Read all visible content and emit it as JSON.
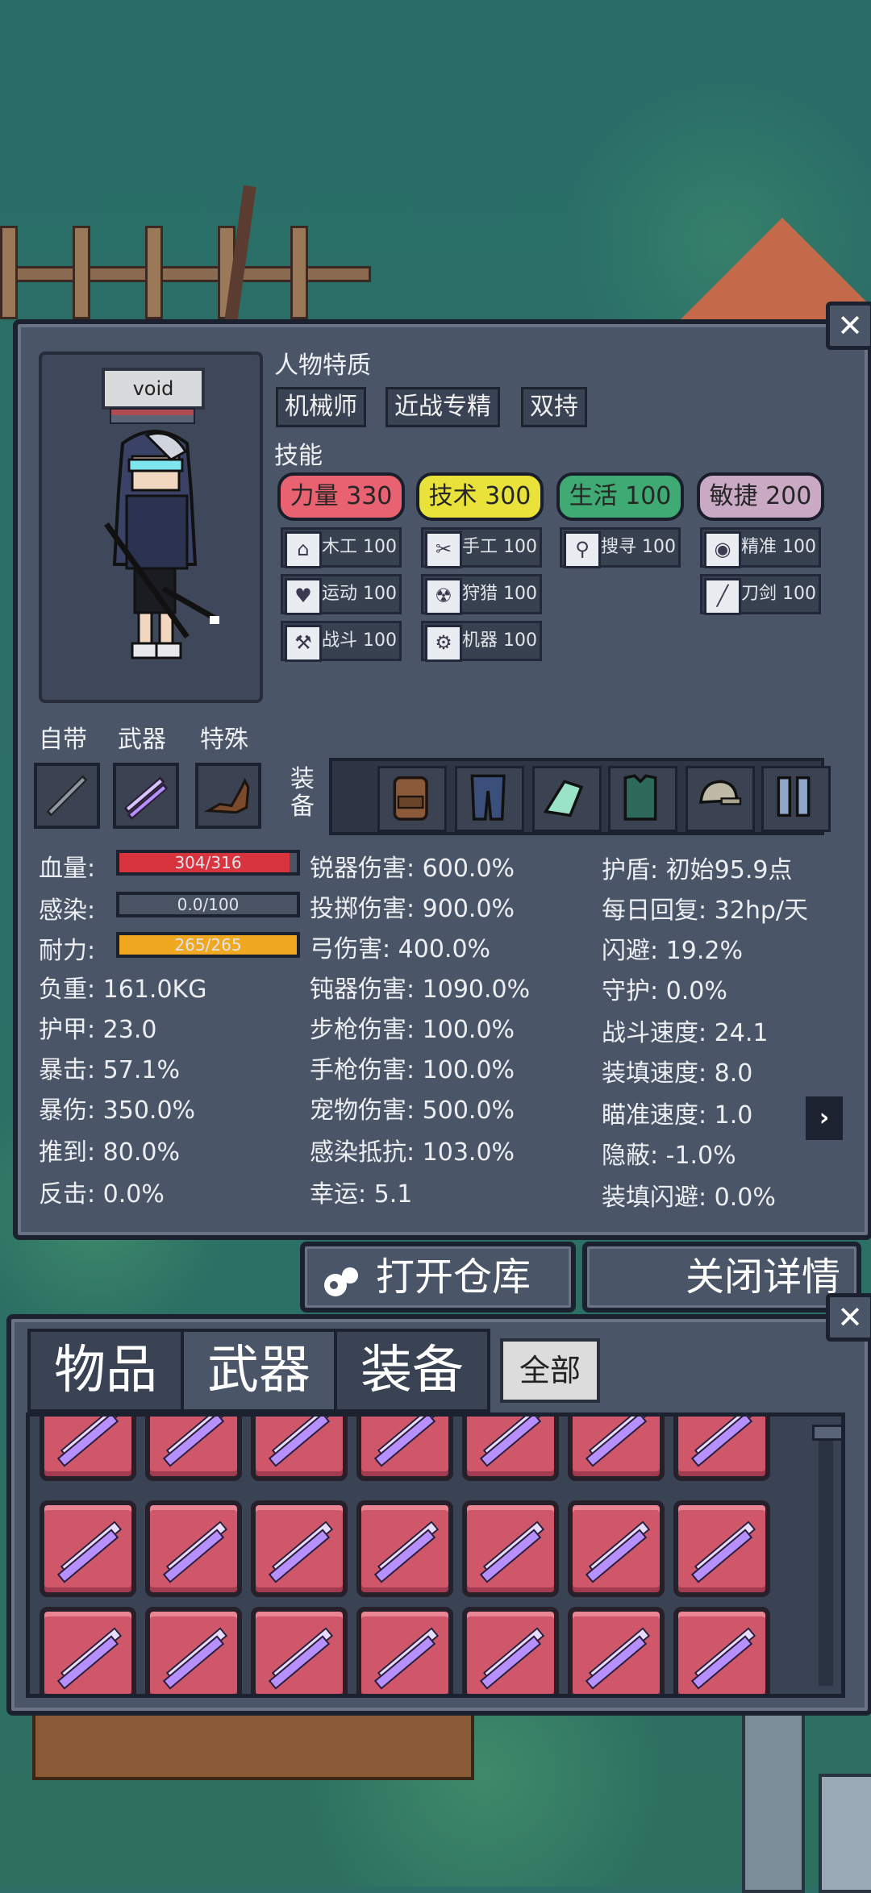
{
  "character": {
    "name": "void",
    "traits_title": "人物特质",
    "traits": [
      "机械师",
      "近战专精",
      "双持"
    ],
    "skills_title": "技能"
  },
  "attributes": [
    {
      "label": "力量 330",
      "color": "#e86272"
    },
    {
      "label": "技术 300",
      "color": "#e8e23a"
    },
    {
      "label": "生活 100",
      "color": "#3faa73"
    },
    {
      "label": "敏捷 200",
      "color": "#c9a9c4"
    }
  ],
  "skills": [
    {
      "icon": "house-icon",
      "glyph": "⌂",
      "label": "木工 100"
    },
    {
      "icon": "scissors-icon",
      "glyph": "✂",
      "label": "手工 100"
    },
    {
      "icon": "magnifier-icon",
      "glyph": "⚲",
      "label": "搜寻 100"
    },
    {
      "icon": "eye-icon",
      "glyph": "◉",
      "label": "精准 100"
    },
    {
      "icon": "heart-icon",
      "glyph": "♥",
      "label": "运动 100"
    },
    {
      "icon": "radiation-icon",
      "glyph": "☢",
      "label": "狩猎 100"
    },
    {
      "icon": "sword-icon",
      "glyph": "╱",
      "label": "刀剑 100"
    },
    {
      "icon": "wrench-icon",
      "glyph": "⚒",
      "label": "战斗 100"
    },
    {
      "icon": "gear-icon",
      "glyph": "⚙",
      "label": "机器 100"
    }
  ],
  "slots": {
    "innate_label": "自带",
    "weapon_label": "武器",
    "special_label": "特殊",
    "equip_label": "装\n备"
  },
  "bars": [
    {
      "label": "血量:",
      "text": "304/316",
      "fill": 0.96,
      "color": "#d8343d"
    },
    {
      "label": "感染:",
      "text": "0.0/100",
      "fill": 0.0,
      "color": "#7a5cc0"
    },
    {
      "label": "耐力:",
      "text": "265/265",
      "fill": 1.0,
      "color": "#f0a820"
    }
  ],
  "stats_col1": [
    "负重: 161.0KG",
    "护甲: 23.0",
    "暴击: 57.1%",
    "暴伤: 350.0%",
    "推到: 80.0%",
    "反击: 0.0%"
  ],
  "stats_col2": [
    "锐器伤害: 600.0%",
    "投掷伤害: 900.0%",
    "弓伤害: 400.0%",
    "钝器伤害: 1090.0%",
    "步枪伤害: 100.0%",
    "手枪伤害: 100.0%",
    "宠物伤害: 500.0%",
    "感染抵抗: 103.0%",
    "幸运: 5.1"
  ],
  "stats_col3": [
    "护盾: 初始95.9点",
    "每日回复: 32hp/天",
    "闪避: 19.2%",
    "守护: 0.0%",
    "战斗速度: 24.1",
    "装填速度: 8.0",
    "瞄准速度: 1.0",
    "隐蔽: -1.0%",
    "装填闪避: 0.0%"
  ],
  "buttons": {
    "open_storage": "打开仓库",
    "close_details": "关闭详情",
    "close_x": "✕",
    "next": "›"
  },
  "inventory": {
    "tabs": [
      "物品",
      "武器",
      "装备"
    ],
    "all_label": "全部",
    "item_count": 21
  }
}
